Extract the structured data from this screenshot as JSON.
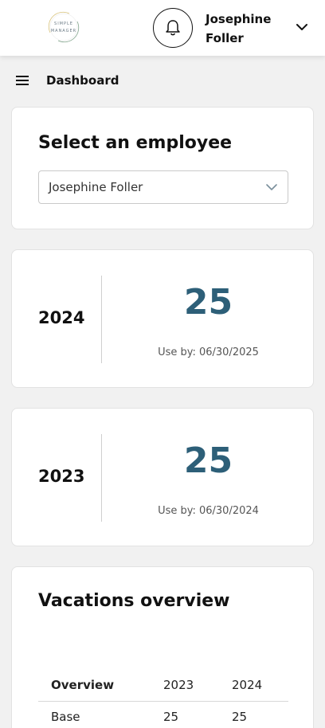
{
  "header": {
    "logo": {
      "line1": "SIMPLE",
      "line2": "MANAGER"
    },
    "notification_icon": "bell-icon",
    "user_name": "Josephine Foller",
    "user_menu_icon": "chevron-down-icon"
  },
  "breadcrumb": {
    "menu_icon": "hamburger-icon",
    "title": "Dashboard"
  },
  "employee_select": {
    "title": "Select an employee",
    "selected": "Josephine Foller",
    "icon": "chevron-down-icon"
  },
  "allowances": [
    {
      "year": "2024",
      "days": "25",
      "use_by": "Use by: 06/30/2025"
    },
    {
      "year": "2023",
      "days": "25",
      "use_by": "Use by: 06/30/2024"
    }
  ],
  "overview": {
    "title": "Vacations overview",
    "columns": [
      "Overview",
      "2023",
      "2024"
    ],
    "rows": [
      [
        "Base",
        "25",
        "25"
      ]
    ]
  },
  "colors": {
    "accent": "#2d5f78",
    "background": "#f1f1f1",
    "card": "#ffffff"
  }
}
